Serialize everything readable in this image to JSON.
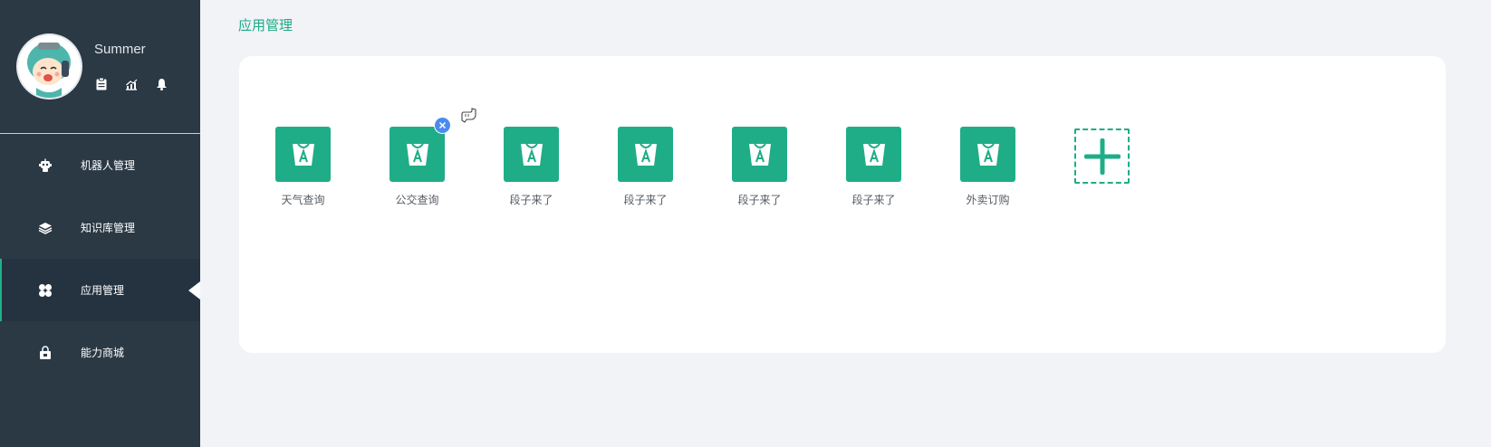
{
  "user": {
    "name": "Summer"
  },
  "profile_icons": [
    "clipboard-icon",
    "chart-icon",
    "bell-icon"
  ],
  "nav": [
    {
      "label": "机器人管理",
      "icon": "robot-icon",
      "active": false
    },
    {
      "label": "知识库管理",
      "icon": "layers-icon",
      "active": false
    },
    {
      "label": "应用管理",
      "icon": "grid-icon",
      "active": true
    },
    {
      "label": "能力商城",
      "icon": "bag-icon",
      "active": false
    }
  ],
  "page": {
    "title": "应用管理"
  },
  "apps": [
    {
      "label": "天气查询"
    },
    {
      "label": "公交查询"
    },
    {
      "label": "段子来了"
    },
    {
      "label": "段子来了"
    },
    {
      "label": "段子来了"
    },
    {
      "label": "段子来了"
    },
    {
      "label": "外卖订购"
    }
  ],
  "colors": {
    "accent": "#1fad87",
    "sidebar": "#2b3945",
    "badge": "#4a8bf0"
  }
}
